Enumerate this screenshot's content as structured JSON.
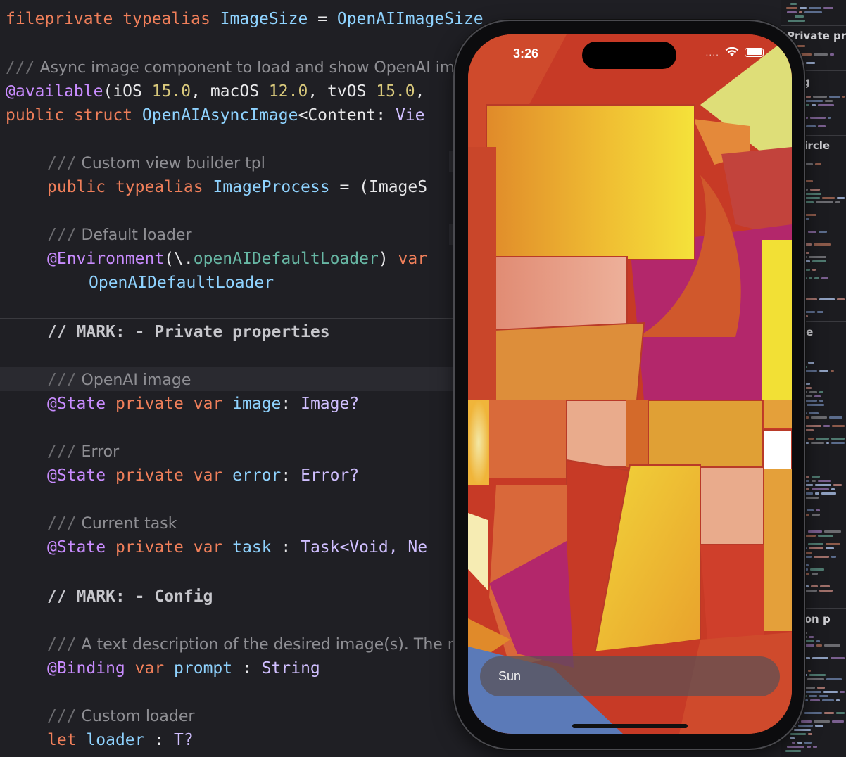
{
  "code": {
    "lines": {
      "l1": {
        "kw1": "fileprivate",
        "kw2": "typealias",
        "name": "ImageSize",
        "eq": " = ",
        "value": "OpenAIImageSize"
      },
      "l2": {
        "slashes": "///",
        "text": " Async image component to load and show OpenAI ima"
      },
      "l3": {
        "attr": "@available",
        "a": "(iOS ",
        "v1": "15.0",
        "b": ", macOS ",
        "v2": "12.0",
        "c": ", tvOS ",
        "v3": "15.0",
        "d": ","
      },
      "l4": {
        "kw1": "public",
        "kw2": "struct",
        "name": "OpenAIAsyncImage",
        "g1": "<Content: ",
        "g2": "Vie"
      },
      "l5": {
        "slashes": "///",
        "text": " Custom view builder tpl"
      },
      "l6": {
        "kw1": "public",
        "kw2": "typealias",
        "name": "ImageProcess",
        "rest": " = (ImageS"
      },
      "l7": {
        "slashes": "///",
        "text": " Default loader"
      },
      "l8": {
        "attr": "@Environment",
        "a": "(\\.",
        "ident": "openAIDefaultLoader",
        "b": ") ",
        "kw": "var"
      },
      "l9": {
        "type": "OpenAIDefaultLoader"
      },
      "l10": {
        "mark": "// MARK: - Private properties"
      },
      "l11": {
        "slashes": "///",
        "text": " OpenAI image"
      },
      "l12": {
        "attr": "@State",
        "kw1": "private",
        "kw2": "var",
        "name": "image",
        "colon": ": ",
        "type": "Image?"
      },
      "l13": {
        "slashes": "///",
        "text": " Error"
      },
      "l14": {
        "attr": "@State",
        "kw1": "private",
        "kw2": "var",
        "name": "error",
        "colon": ": ",
        "type": "Error?"
      },
      "l15": {
        "slashes": "///",
        "text": " Current task"
      },
      "l16": {
        "attr": "@State",
        "kw1": "private",
        "kw2": "var",
        "name": "task",
        "colon": " : ",
        "type": "Task<Void, Ne"
      },
      "l17": {
        "mark": "// MARK: - Config"
      },
      "l18": {
        "slashes": "///",
        "text": " A text description of the desired image(s). The ma"
      },
      "l19": {
        "attr": "@Binding",
        "kw": "var",
        "name": "prompt",
        "colon": " : ",
        "type": "String"
      },
      "l20": {
        "slashes": "///",
        "text": " Custom loader"
      },
      "l21": {
        "kw": "let",
        "name": "loader",
        "colon": " : ",
        "type": "T?"
      }
    }
  },
  "minimap": {
    "labels": {
      "private": "Private pro",
      "config": "nfig",
      "circle": "e circle",
      "vate": "vate",
      "extension": "nsion p"
    }
  },
  "phone": {
    "status_time": "3:26",
    "status_dots": "....",
    "prompt_value": "Sun"
  },
  "colors": {
    "editor_bg": "#1f1f24",
    "keyword": "#f07f5a",
    "type": "#8fd3ff",
    "number": "#d9c97c",
    "attribute": "#c98cff",
    "comment": "#8e8e93"
  }
}
